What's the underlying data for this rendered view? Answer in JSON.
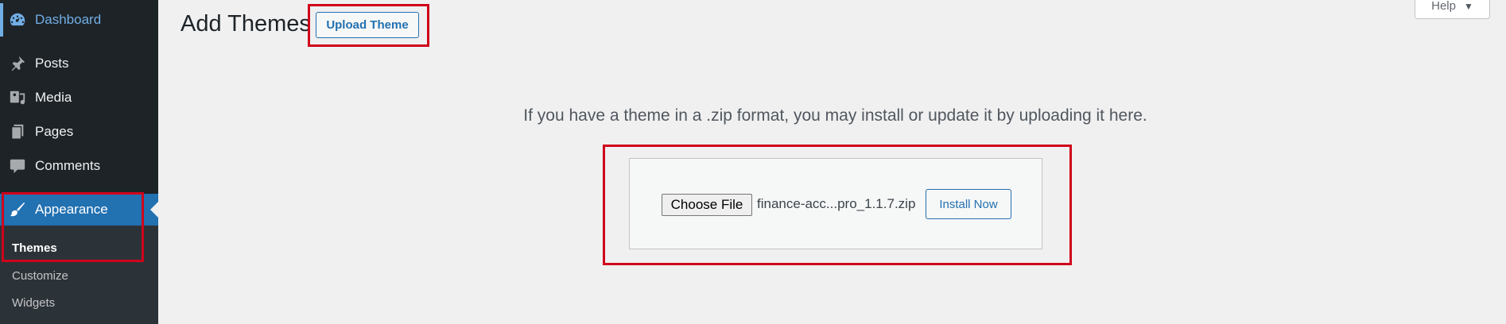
{
  "sidebar": {
    "items": [
      {
        "label": "Dashboard",
        "icon": "dashboard-icon"
      },
      {
        "label": "Posts",
        "icon": "pin-icon"
      },
      {
        "label": "Media",
        "icon": "media-icon"
      },
      {
        "label": "Pages",
        "icon": "pages-icon"
      },
      {
        "label": "Comments",
        "icon": "comment-icon"
      },
      {
        "label": "Appearance",
        "icon": "paintbrush-icon"
      }
    ],
    "submenu": [
      {
        "label": "Themes"
      },
      {
        "label": "Customize"
      },
      {
        "label": "Widgets"
      }
    ]
  },
  "header": {
    "title": "Add Themes",
    "upload_label": "Upload Theme",
    "help_label": "Help"
  },
  "upload": {
    "instructions": "If you have a theme in a .zip format, you may install or update it by uploading it here.",
    "choose_label": "Choose File",
    "file_name": "finance-acc...pro_1.1.7.zip",
    "install_label": "Install Now"
  },
  "colors": {
    "sidebar_bg": "#1d2327",
    "submenu_bg": "#2c3338",
    "accent": "#2271b1",
    "highlight": "#d0021b"
  }
}
